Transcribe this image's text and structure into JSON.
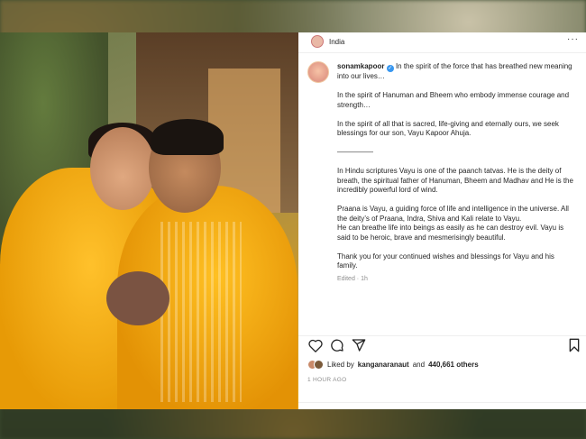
{
  "post": {
    "location": "India",
    "username": "sonamkapoor",
    "caption": [
      "In the spirit of the force that has breathed new meaning into our lives…",
      "In the spirit of Hanuman and Bheem who embody immense courage and strength…",
      "In the spirit of all that is sacred, life-giving and eternally ours, we seek blessings for our son, Vayu Kapoor Ahuja.",
      "—————",
      "In Hindu scriptures Vayu is one of the paanch tatvas. He is the deity of breath, the spiritual father of Hanuman, Bheem and Madhav and He is the incredibly powerful lord of wind.",
      "Praana is Vayu, a guiding force of life and intelligence in the universe. All the deity’s of Praana, Indra, Shiva and Kali relate to Vayu.",
      "He can breathe life into beings as easily as he can destroy evil. Vayu is said to be heroic, brave and mesmerisingly beautiful.",
      "Thank you for your continued wishes and blessings for Vayu and his family."
    ],
    "edited": "Edited · 1h",
    "liked_by_prefix": "Liked by",
    "liked_by_user": "kanganaranaut",
    "liked_by_and": "and",
    "likes_count": "440,661 others",
    "timestamp": "1 HOUR AGO",
    "more_icon": "···"
  },
  "colors": {
    "verified": "#3897f0",
    "text": "#262626",
    "muted": "#8e8e8e",
    "saffron": "#f2a20c"
  },
  "icons": [
    "heart-icon",
    "comment-icon",
    "share-icon",
    "bookmark-icon"
  ]
}
